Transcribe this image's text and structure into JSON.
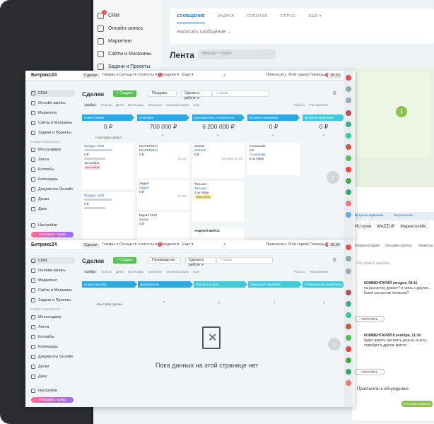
{
  "background_window": {
    "sidebar": [
      {
        "label": "CRM",
        "badge": "1"
      },
      {
        "label": "Онлайн-запись"
      },
      {
        "label": "Маркетинг"
      },
      {
        "label": "Сайты и Магазины"
      },
      {
        "label": "Задачи и Проекты"
      }
    ],
    "post_tabs": [
      "СООБЩЕНИЕ",
      "ЗАДАЧА",
      "СОБЫТИЕ",
      "ОПРОС",
      "ЕЩЁ ▾"
    ],
    "post_placeholder": "Написать сообщение ...",
    "feed_title": "Лента",
    "feed_filter": "Фильтр + поиск"
  },
  "right_panel": {
    "stages": [
      "Встреча первичная",
      "Встреча пов..."
    ],
    "tabs": [
      "История",
      "WAZZUP",
      "Маркетплейс"
    ],
    "tabs2": [
      "Комментарий",
      "Онлайн-запись",
      "Заметка"
    ],
    "placeholder": "Что нужно сделать",
    "messages": [
      {
        "head": "КОММЕНТАРИЙ  сегодня, 08:11",
        "text": "па рассрочку думает? и связь с другим... Какие рассрочки посмыли?"
      },
      {
        "head": "КОММЕНТАРИЙ  8 октября, 11:34",
        "text": "будет думать где взять деньги, в цену... подойдет в другим кристи..."
      }
    ],
    "button_reply": "УКРЕПИТЬ",
    "invite": "Пригласить к обсуждению",
    "green_btn": "Что нужно сделать"
  },
  "window1": {
    "logo": "Битрикс24",
    "top_tabs": [
      "Сделки",
      "Товары и Склады ▾",
      "Клиенты ▾",
      "Продажи ▾",
      "Ещё ▾"
    ],
    "top_right": [
      "Пригласить",
      "Мой тариф",
      "Помощь",
      "15:33"
    ],
    "sidebar": [
      "CRM",
      "Онлайн-запись",
      "Маркетинг",
      "Сайты и Магазины",
      "Задачи и Проекты",
      "Мессенджер",
      "Лента",
      "Коллабы",
      "Календарь",
      "Документы Онлайн",
      "Доски",
      "Диск"
    ],
    "sidebar_head": "Совместная работа",
    "settings": "Настройки",
    "tariff": "Расширить тариф",
    "title": "Сделки",
    "create": "+ Создать",
    "pipeline": "Продажи",
    "filter_pill": "Сделки в работе ✕",
    "search_placeholder": "+ поиск",
    "subtabs": [
      "Канбан",
      "Список",
      "Дела",
      "Календарь"
    ],
    "right_controls": [
      "Роботы",
      "Расширения"
    ],
    "toolbar_pills": [
      "Внешние",
      "Автоматизация",
      "Ещё"
    ],
    "stages": [
      {
        "label": "Новая заявка",
        "color": "#2fa8e0",
        "sum": "0 ₽"
      },
      {
        "label": "Недозвон",
        "color": "#2fa8e0",
        "sum": "700 000 ₽"
      },
      {
        "label": "Договорились созвониться",
        "color": "#2fa8e0",
        "sum": "6 200 000 ₽"
      },
      {
        "label": "Встреча назначена",
        "color": "#2fa8e0",
        "sum": "0 ₽"
      },
      {
        "label": "Встреча первичная",
        "color": "#47c8d8",
        "sum": "0 ₽"
      }
    ],
    "quick_add": "+ Быстрая сделка",
    "cards": [
      {
        "title": "Продукт 2026",
        "client": "",
        "sum": "0 ₽",
        "date": "15 ноября",
        "tag": "нет ответа"
      },
      {
        "title": "ЕКАТЕРИНА",
        "client": "ЕКАТЕРИНА",
        "sum": "0 ₽",
        "date": "20 Окт"
      },
      {
        "title": "Жанна",
        "client": "ЖАННА",
        "sum": "0 ₽",
        "date": "Сегодня 12:58"
      },
      {
        "title": "Станислав",
        "client": "Станислав",
        "sum": "0 ₽",
        "date": "8 октября"
      },
      {
        "title": "Лидия",
        "client": "Лидия",
        "sum": "0 ₽",
        "date": "22 Окт"
      },
      {
        "title": "Татьяна",
        "client": "Татьяна",
        "sum": "2 октября",
        "date": "",
        "tag": "завершено"
      },
      {
        "title": "Мария #204",
        "client": "мария",
        "sum": "0 ₽",
        "date": "5 октября"
      },
      {
        "title": "АНДРЕЙ ВЕЙСК",
        "client": "",
        "sum": "",
        "date": ""
      }
    ]
  },
  "window2": {
    "logo": "Битрикс24",
    "top_tabs": [
      "Сделки",
      "Товары и Склады ▾",
      "Клиенты ▾",
      "Продажи ▾",
      "Ещё ▾"
    ],
    "top_right": [
      "Пригласить",
      "Мой тариф",
      "Помощь",
      "15:34"
    ],
    "sidebar": [
      "CRM",
      "Онлайн-запись",
      "Маркетинг",
      "Сайты и Магазины",
      "Задачи и Проекты",
      "Мессенджер",
      "Лента",
      "Коллабы",
      "Календарь",
      "Документы Онлайн",
      "Доски",
      "Диск"
    ],
    "sidebar_head": "Совместная работа",
    "settings": "Настройки",
    "tariff": "Расширить тариф",
    "title": "Сделки",
    "create": "+ Создать",
    "pipeline": "Производство",
    "filter_pill": "Сделки в работе ✕",
    "search_placeholder": "+ поиск",
    "subtabs": [
      "Канбан",
      "Список",
      "Дела",
      "Календарь"
    ],
    "right_controls": [
      "Роботы",
      "Расширения"
    ],
    "toolbar_pills": [
      "Внешние",
      "Автоматизация",
      "Ещё"
    ],
    "stages": [
      {
        "label": "Новый договор",
        "color": "#2fa8e0"
      },
      {
        "label": "Дизайнбланк",
        "color": "#2fa8e0"
      },
      {
        "label": "Подпись в срок",
        "color": "#47c8d8"
      },
      {
        "label": "Заводские сведения",
        "color": "#47c8d8"
      },
      {
        "label": "Установка без доработки",
        "color": "#47c8d8"
      }
    ],
    "quick_add": "+ Быстрая сделка",
    "empty_text": "Пока данных на этой странице нет"
  }
}
